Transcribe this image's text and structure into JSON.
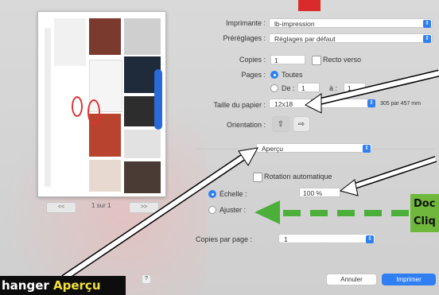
{
  "form": {
    "printer_label": "Imprimante :",
    "printer_value": "lb-impression",
    "presets_label": "Préréglages :",
    "presets_value": "Réglages par défaut",
    "copies_label": "Copies :",
    "copies_value": "1",
    "duplex_label": "Recto verso",
    "pages_label": "Pages :",
    "pages_all": "Toutes",
    "pages_from": "De :",
    "pages_from_value": "1",
    "pages_to_label": "à :",
    "pages_to_value": "1",
    "paper_label": "Taille du papier :",
    "paper_value": "12x18",
    "paper_dims": "305 par 457 mm",
    "orientation_label": "Orientation :",
    "section_value": "Aperçu",
    "auto_rotate_label": "Rotation automatique",
    "scale_label": "Échelle :",
    "scale_value": "100 %",
    "fit_label": "Ajuster :",
    "copies_per_page_label": "Copies par page :",
    "copies_per_page_value": "1"
  },
  "preview": {
    "prev_label": "<<",
    "prev2_label": "<",
    "page_indicator": "1 sur 1",
    "next_label": ">",
    "next2_label": ">>"
  },
  "buttons": {
    "cancel": "Annuler",
    "print": "Imprimer",
    "help": "?"
  },
  "annotations": {
    "callout_prefix": "hanger ",
    "callout_highlight": "Aperçu",
    "green_line1": "Doc",
    "green_line2": "Cliq"
  },
  "colors": {
    "accent": "#2f7ff3",
    "arrow_green": "#4caf3a",
    "callout_bg": "#0d0d0d",
    "callout_highlight": "#f3e23a"
  }
}
